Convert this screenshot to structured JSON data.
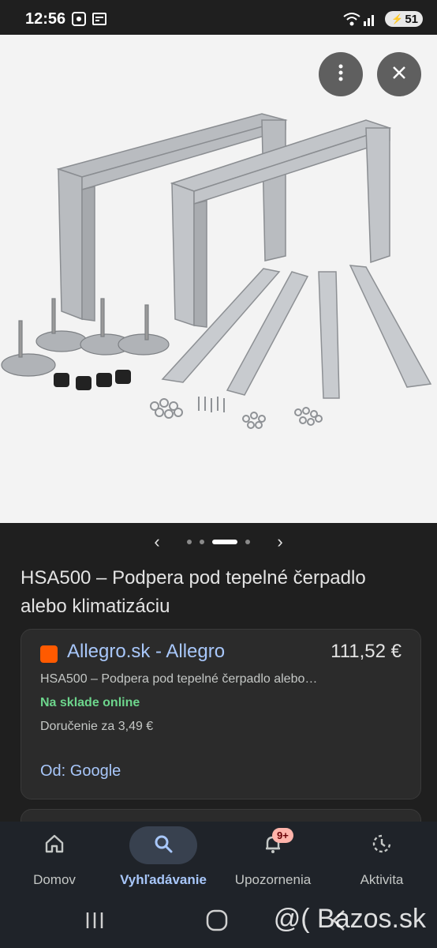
{
  "status_bar": {
    "time": "12:56",
    "battery": "51",
    "icons": [
      "screenshot-icon",
      "news-icon",
      "wifi-icon",
      "signal-icon",
      "battery-icon"
    ]
  },
  "image_viewer": {
    "image_description_icon": "product-image",
    "more_button_icon": "more-vert-icon",
    "close_button_icon": "close-icon",
    "carousel_prev_icon": "chevron-left-icon",
    "carousel_next_icon": "chevron-right-icon",
    "carousel_dot_count": 4,
    "carousel_active_index": 2
  },
  "product": {
    "title": "HSA500 – Podpera pod tepelné čerpadlo alebo klimatizáciu"
  },
  "offer": {
    "merchant": "Allegro.sk - Allegro",
    "price": "111,52 €",
    "description": "HSA500 – Podpera pod tepelné čerpadlo alebo…",
    "availability": "Na sklade online",
    "delivery": "Doručenie za 3,49 €",
    "source": "Od: Google",
    "merchant_color": "#ff5a00"
  },
  "bottom_nav": {
    "items": [
      {
        "label": "Domov",
        "icon": "home-icon"
      },
      {
        "label": "Vyhľadávanie",
        "icon": "search-icon"
      },
      {
        "label": "Upozornenia",
        "icon": "bell-icon",
        "badge": "9+"
      },
      {
        "label": "Aktivita",
        "icon": "activity-icon"
      }
    ],
    "active_index": 1
  },
  "watermark": "@( Bazos.sk",
  "colors": {
    "background": "#1f1f1f",
    "link": "#a8c7fa",
    "in_stock": "#6dd58c"
  }
}
